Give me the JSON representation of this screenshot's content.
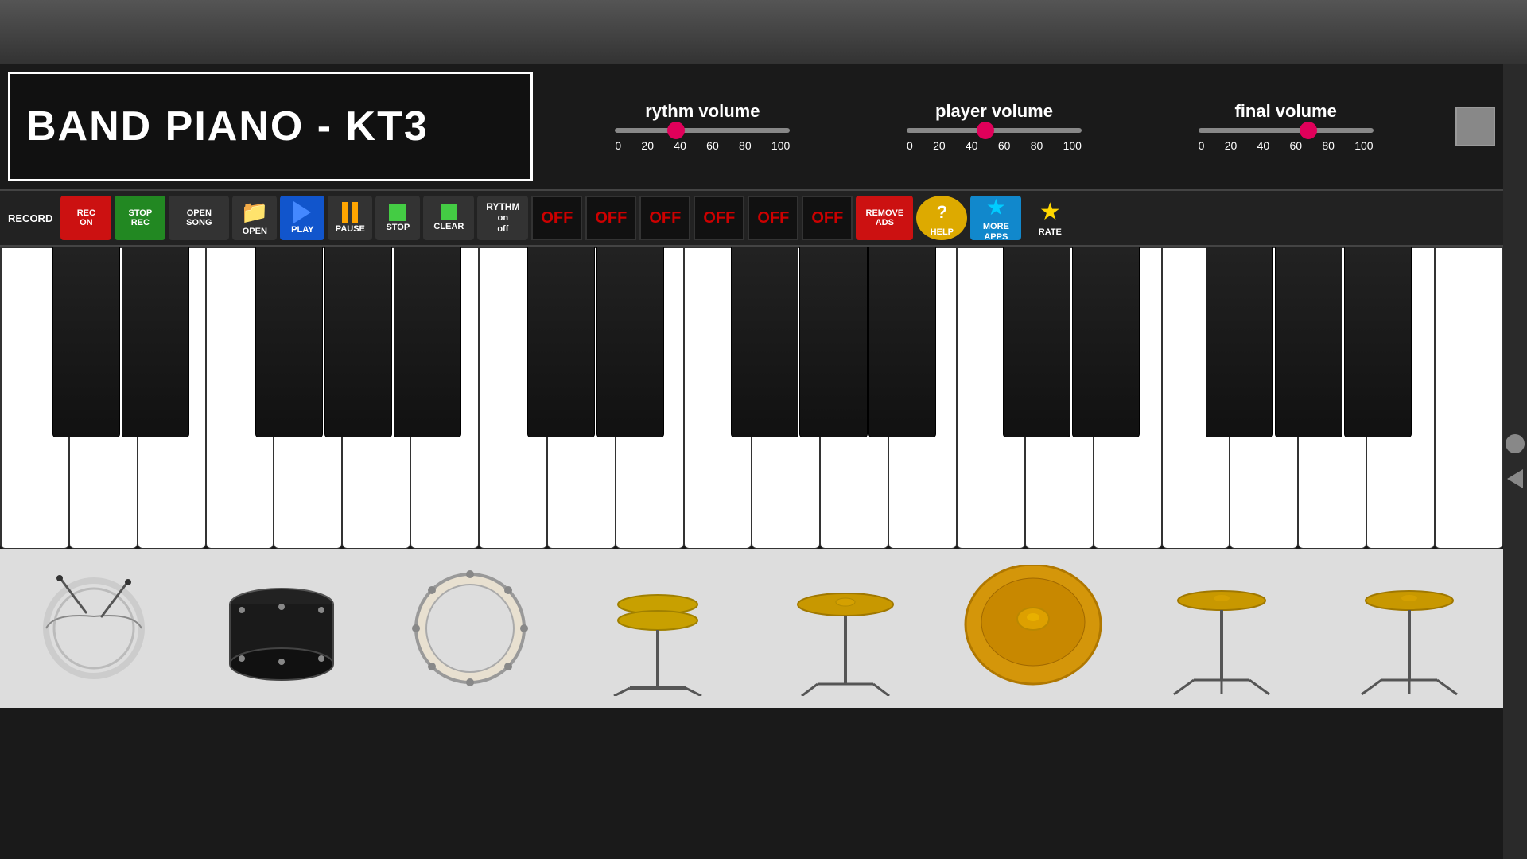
{
  "app": {
    "title": "BAND PIANO - KT3"
  },
  "header": {
    "rythm_volume_label": "rythm volume",
    "player_volume_label": "player volume",
    "final_volume_label": "final volume",
    "rythm_slider_value": 35,
    "player_slider_value": 45,
    "final_slider_value": 65,
    "slider_marks": [
      "0",
      "20",
      "40",
      "60",
      "80",
      "100"
    ]
  },
  "toolbar": {
    "record_label": "RECORD",
    "rec_on_label": "REC\nON",
    "stop_rec_label": "STOP\nREC",
    "open_song_label": "OPEN\nSONG",
    "open_label": "OPEN",
    "play_label": "PLAY",
    "pause_label": "PAUSE",
    "stop_label": "STOP",
    "clear_label": "CLEAR",
    "rythm_on_label": "RYTHM\non\noff",
    "off_buttons": [
      "OFF",
      "OFF",
      "OFF",
      "OFF",
      "OFF",
      "OFF"
    ],
    "remove_ads_label": "REMOVE\nADS",
    "help_label": "HELP",
    "more_apps_label": "MORE\nAPPS",
    "rate_label": "RATE"
  },
  "piano": {
    "white_keys_count": 22,
    "black_key_positions": [
      6.2,
      13.0,
      23.5,
      30.3,
      37.1,
      48.6,
      55.4,
      66.9,
      73.7,
      80.5,
      91.9
    ]
  },
  "drums": [
    {
      "name": "snare-drum",
      "label": "Snare Drum"
    },
    {
      "name": "bass-drum-2",
      "label": "Tom"
    },
    {
      "name": "bass-drum",
      "label": "Bass Drum"
    },
    {
      "name": "hi-hat-stand",
      "label": "Hi-Hat Stand"
    },
    {
      "name": "cymbal-stand",
      "label": "Cymbal Stand"
    },
    {
      "name": "ride-cymbal",
      "label": "Ride Cymbal"
    },
    {
      "name": "cymbal-stand-2",
      "label": "Cymbal Stand 2"
    },
    {
      "name": "cymbal-stand-3",
      "label": "Cymbal Stand 3"
    }
  ]
}
